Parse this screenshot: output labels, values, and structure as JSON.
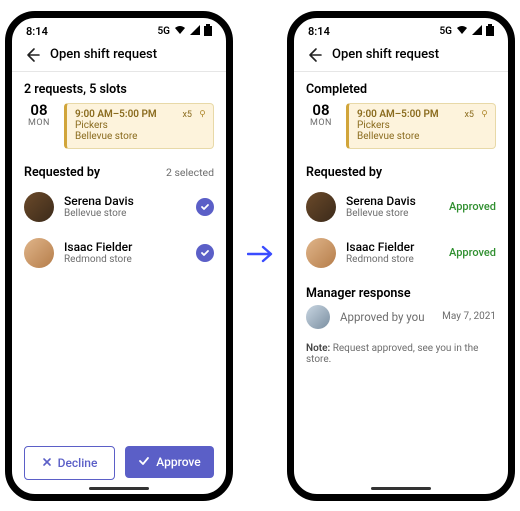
{
  "status": {
    "time": "8:14",
    "network": "5G"
  },
  "header": {
    "title": "Open shift request"
  },
  "left": {
    "summary": "2 requests, 5 slots",
    "date": {
      "day": "08",
      "dow": "MON"
    },
    "shift": {
      "time": "9:00 AM–5:00 PM",
      "role": "Pickers",
      "store": "Bellevue store",
      "slots": "x5"
    },
    "requested_title": "Requested by",
    "selected_text": "2 selected",
    "people": [
      {
        "name": "Serena Davis",
        "store": "Bellevue store"
      },
      {
        "name": "Isaac Fielder",
        "store": "Redmond store"
      }
    ],
    "decline": "Decline",
    "approve": "Approve"
  },
  "right": {
    "summary": "Completed",
    "date": {
      "day": "08",
      "dow": "MON"
    },
    "shift": {
      "time": "9:00 AM–5:00 PM",
      "role": "Pickers",
      "store": "Bellevue store",
      "slots": "x5"
    },
    "requested_title": "Requested by",
    "people": [
      {
        "name": "Serena Davis",
        "store": "Bellevue store",
        "status": "Approved"
      },
      {
        "name": "Isaac Fielder",
        "store": "Redmond store",
        "status": "Approved"
      }
    ],
    "mgr_title": "Manager response",
    "mgr_text": "Approved by you",
    "mgr_date": "May 7, 2021",
    "note_label": "Note:",
    "note_text": "Request approved, see you in the store."
  }
}
